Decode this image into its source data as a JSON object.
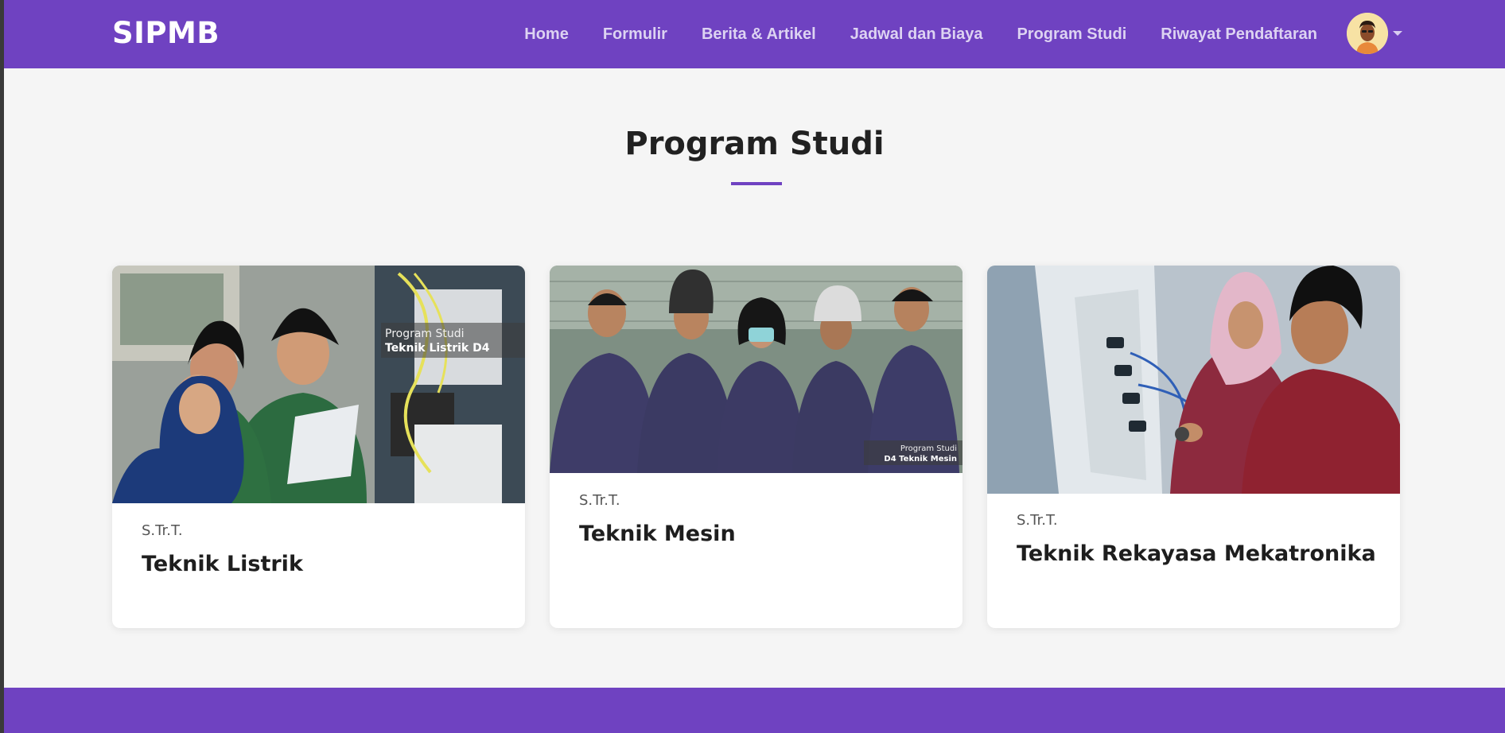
{
  "navbar": {
    "brand": "SIPMB",
    "links": [
      "Home",
      "Formulir",
      "Berita & Artikel",
      "Jadwal dan Biaya",
      "Program Studi",
      "Riwayat Pendaftaran"
    ],
    "avatar_icon": "user-avatar-icon",
    "dropdown_icon": "caret-down-icon"
  },
  "page": {
    "title": "Program Studi"
  },
  "programs": [
    {
      "degree": "S.Tr.T.",
      "name": "Teknik Listrik",
      "image_overlay_small": "Program Studi",
      "image_overlay_large": "Teknik Listrik D4"
    },
    {
      "degree": "S.Tr.T.",
      "name": "Teknik Mesin",
      "image_overlay_small": "Program Studi",
      "image_overlay_large": "D4 Teknik Mesin"
    },
    {
      "degree": "S.Tr.T.",
      "name": "Teknik Rekayasa Mekatronika"
    }
  ],
  "colors": {
    "primary": "#6f42c1",
    "background": "#f5f5f5",
    "card": "#ffffff"
  }
}
